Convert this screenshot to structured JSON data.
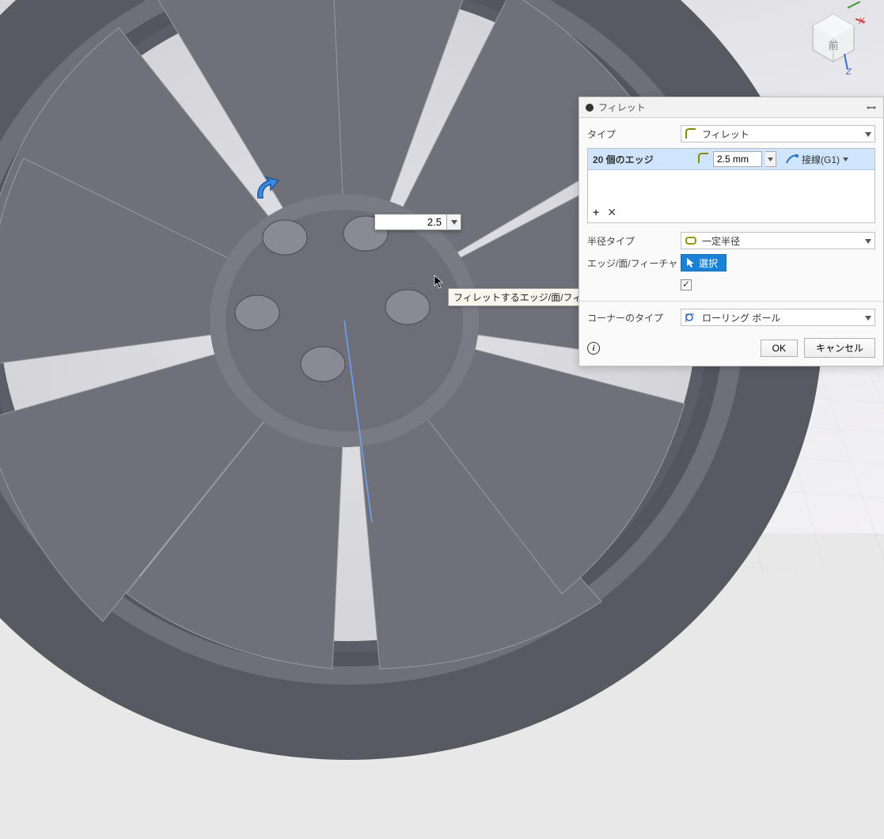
{
  "panel": {
    "title": "フィレット",
    "type_label": "タイプ",
    "type_value": "フィレット",
    "selection": {
      "count_text": "20 個のエッジ",
      "radius_value": "2.5 mm",
      "continuity_label": "接線(G1)"
    },
    "radius_type_label": "半径タイプ",
    "radius_type_value": "一定半径",
    "edges_label": "エッジ/面/フィーチャ",
    "select_button": "選択",
    "corner_type_label": "コーナーのタイプ",
    "corner_type_value": "ローリング ボール",
    "ok": "OK",
    "cancel": "キャンセル"
  },
  "floating_input": {
    "value": "2.5"
  },
  "tooltip": "フィレットするエッジ/面/フィーチャを選択",
  "viewcube": {
    "face": "前"
  },
  "axes": {
    "x": "X",
    "z": "Z"
  }
}
